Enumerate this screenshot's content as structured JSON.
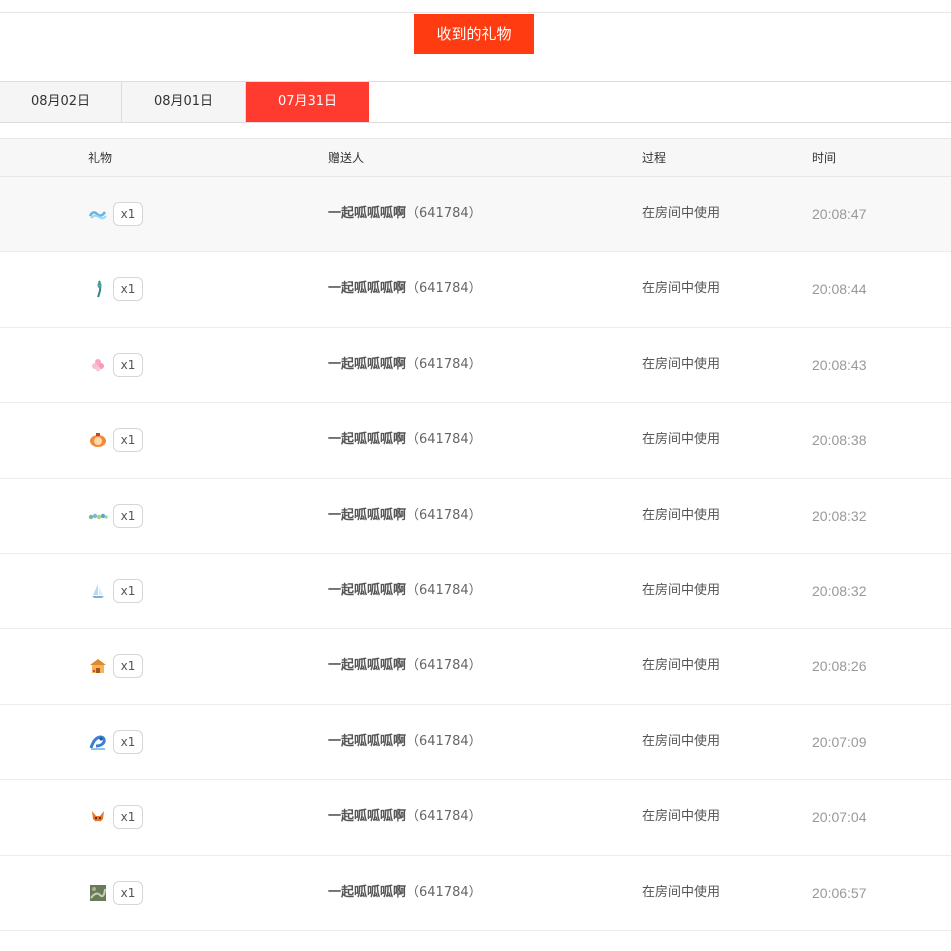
{
  "header": {
    "received_button_label": "收到的礼物"
  },
  "tabs": [
    {
      "label": "08月02日",
      "active": false
    },
    {
      "label": "08月01日",
      "active": false
    },
    {
      "label": "07月31日",
      "active": true
    }
  ],
  "table": {
    "columns": {
      "gift": "礼物",
      "sender": "赠送人",
      "process": "过程",
      "time": "时间"
    },
    "rows": [
      {
        "icon": "water-wave-gift-icon",
        "qty": "x1",
        "sender_name": "一起呱呱呱啊",
        "sender_id": "（641784）",
        "process": "在房间中使用",
        "time": "20:08:47"
      },
      {
        "icon": "peacock-feather-gift-icon",
        "qty": "x1",
        "sender_name": "一起呱呱呱啊",
        "sender_id": "（641784）",
        "process": "在房间中使用",
        "time": "20:08:44"
      },
      {
        "icon": "pink-flower-gift-icon",
        "qty": "x1",
        "sender_name": "一起呱呱呱啊",
        "sender_id": "（641784）",
        "process": "在房间中使用",
        "time": "20:08:43"
      },
      {
        "icon": "lantern-gift-icon",
        "qty": "x1",
        "sender_name": "一起呱呱呱啊",
        "sender_id": "（641784）",
        "process": "在房间中使用",
        "time": "20:08:38"
      },
      {
        "icon": "colorful-beads-gift-icon",
        "qty": "x1",
        "sender_name": "一起呱呱呱啊",
        "sender_id": "（641784）",
        "process": "在房间中使用",
        "time": "20:08:32"
      },
      {
        "icon": "sailboat-gift-icon",
        "qty": "x1",
        "sender_name": "一起呱呱呱啊",
        "sender_id": "（641784）",
        "process": "在房间中使用",
        "time": "20:08:32"
      },
      {
        "icon": "pavilion-gift-icon",
        "qty": "x1",
        "sender_name": "一起呱呱呱啊",
        "sender_id": "（641784）",
        "process": "在房间中使用",
        "time": "20:08:26"
      },
      {
        "icon": "blue-dragon-gift-icon",
        "qty": "x1",
        "sender_name": "一起呱呱呱啊",
        "sender_id": "（641784）",
        "process": "在房间中使用",
        "time": "20:07:09"
      },
      {
        "icon": "fox-gift-icon",
        "qty": "x1",
        "sender_name": "一起呱呱呱啊",
        "sender_id": "（641784）",
        "process": "在房间中使用",
        "time": "20:07:04"
      },
      {
        "icon": "painting-gift-icon",
        "qty": "x1",
        "sender_name": "一起呱呱呱啊",
        "sender_id": "（641784）",
        "process": "在房间中使用",
        "time": "20:06:57"
      }
    ]
  },
  "colors": {
    "accent": "#ff3b12",
    "active_tab": "#ff3b30",
    "time_text": "#999999"
  }
}
